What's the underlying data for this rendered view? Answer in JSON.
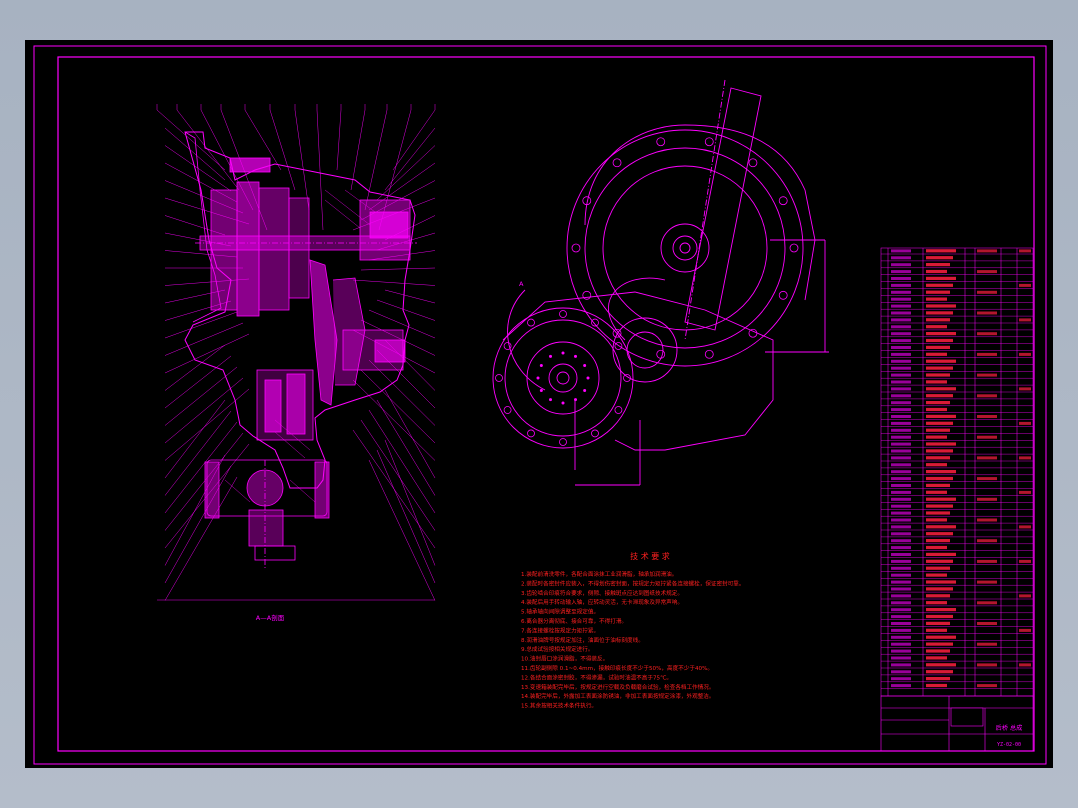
{
  "drawing": {
    "section_label": "A—A剖面",
    "view_label": "A",
    "notes_title": "技 术 要 求",
    "notes": [
      "1.装配前清洗零件，各配合面涂抹工业润滑脂，轴承加润滑油。",
      "2.装配时各密封件应装入，不得划伤密封面，按规定力矩拧紧各连接螺栓，保证密封可靠。",
      "3.齿轮啮合印痕符合要求，侧隙、接触斑点应达到图纸技术规定。",
      "4.装配后用手转动输入轴，应转动灵活，无卡滞现象及异常声响。",
      "5.轴承轴向间隙调整至规定值。",
      "6.离合器分离彻底、接合可靠，不得打滑。",
      "7.各连接螺栓按规定力矩拧紧。",
      "8.润滑油牌号按规定加注，油面位于油标刻度线。",
      "9.总成试验按相关规定进行。",
      "10.油封唇口涂润滑脂，不得装反。",
      "11.齿轮副侧隙  0.1~0.4mm，接触印痕长度不少于50%，高度不少于40%。",
      "12.各结合面涂密封胶，不得渗漏，试验时油温不高于75℃。",
      "13.变速箱装配完毕后，按规定进行空载及负载磨合试验，检查各档工作情况。",
      "14.装配完毕后，外露加工表面涂防锈油，非加工表面按规定涂漆，外观整洁。",
      "15.其余按相关技术条件执行。"
    ],
    "title_block": {
      "part_name": "后桥 总成",
      "drawing_no": "YZ-02-00"
    }
  }
}
